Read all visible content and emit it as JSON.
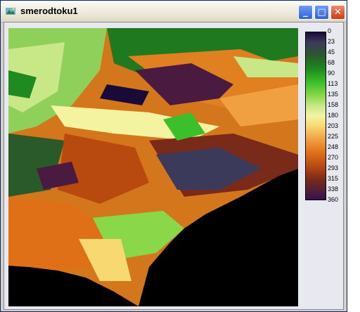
{
  "window": {
    "title": "smerodtoku1",
    "buttons": {
      "minimize": "_",
      "maximize": "□",
      "close": "✕"
    }
  },
  "legend": {
    "labels": [
      "0",
      "23",
      "45",
      "68",
      "90",
      "113",
      "135",
      "158",
      "180",
      "203",
      "225",
      "248",
      "270",
      "293",
      "315",
      "338",
      "360"
    ]
  },
  "colors": {
    "window_border": "#0a246a",
    "client_bg": "#e8e8f0",
    "nodata": "#000000"
  }
}
